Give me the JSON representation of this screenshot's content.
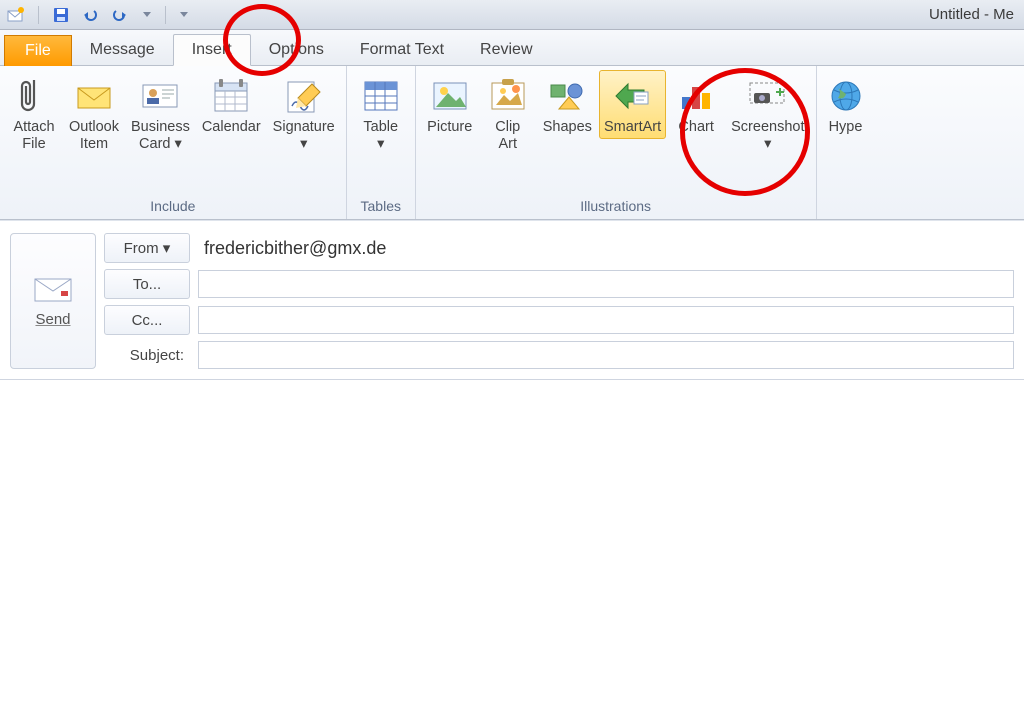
{
  "window": {
    "title": "Untitled - Me"
  },
  "tabs": {
    "file": "File",
    "items": [
      "Message",
      "Insert",
      "Options",
      "Format Text",
      "Review"
    ],
    "active_index": 1
  },
  "ribbon": {
    "groups": [
      {
        "label": "Include",
        "items": [
          {
            "name": "attach-file",
            "label": "Attach\nFile",
            "dropdown": false
          },
          {
            "name": "outlook-item",
            "label": "Outlook\nItem",
            "dropdown": false
          },
          {
            "name": "business-card",
            "label": "Business\nCard ▾",
            "dropdown": true
          },
          {
            "name": "calendar",
            "label": "Calendar",
            "dropdown": false
          },
          {
            "name": "signature",
            "label": "Signature\n▾",
            "dropdown": true
          }
        ]
      },
      {
        "label": "Tables",
        "items": [
          {
            "name": "table",
            "label": "Table\n▾",
            "dropdown": true
          }
        ]
      },
      {
        "label": "Illustrations",
        "items": [
          {
            "name": "picture",
            "label": "Picture",
            "dropdown": false
          },
          {
            "name": "clip-art",
            "label": "Clip\nArt",
            "dropdown": false
          },
          {
            "name": "shapes",
            "label": "Shapes",
            "dropdown": false
          },
          {
            "name": "smartart",
            "label": "SmartArt",
            "dropdown": false,
            "highlight": true
          },
          {
            "name": "chart",
            "label": "Chart",
            "dropdown": false
          },
          {
            "name": "screenshot",
            "label": "Screenshot\n▾",
            "dropdown": true
          }
        ]
      },
      {
        "label": "",
        "items": [
          {
            "name": "hyperlink",
            "label": "Hype",
            "dropdown": false
          }
        ]
      }
    ]
  },
  "compose": {
    "send": "Send",
    "from_label": "From ▾",
    "from_value": "fredericbither@gmx.de",
    "to_label": "To...",
    "cc_label": "Cc...",
    "subject_label": "Subject:"
  }
}
